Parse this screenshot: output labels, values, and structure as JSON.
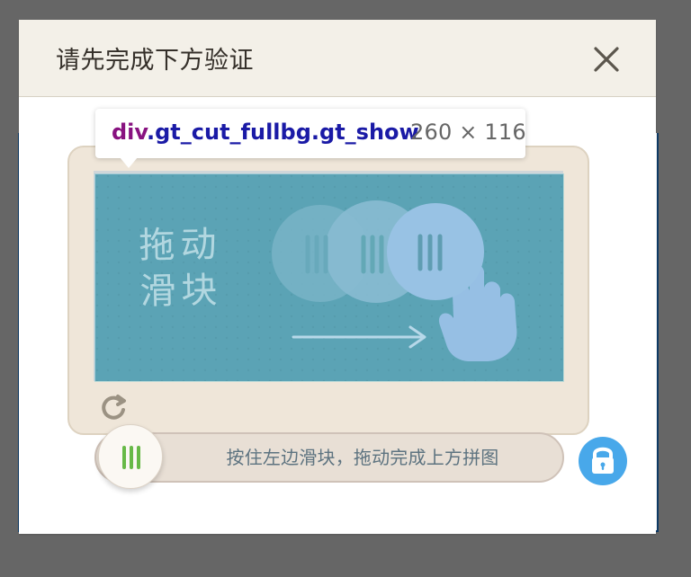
{
  "modal": {
    "title": "请先完成下方验证"
  },
  "inspect_tooltip": {
    "tag": "div",
    "class_name": ".gt_cut_fullbg.gt_show",
    "size": "260 × 116"
  },
  "captcha": {
    "prompt_line1": "拖动",
    "prompt_line2": "滑块",
    "slider_tip": "按住左边滑块，拖动完成上方拼图"
  },
  "colors": {
    "header_background": "#f3f0e8",
    "captcha_background": "#55a2a8",
    "lock_accent": "#48a8ea",
    "handle_green": "#67b947"
  },
  "icons": {
    "close": "close-icon",
    "refresh": "refresh-icon",
    "lock": "lock-icon",
    "hand": "hand-icon",
    "arrow": "arrow-right-icon",
    "grip": "grip-lines-icon"
  }
}
